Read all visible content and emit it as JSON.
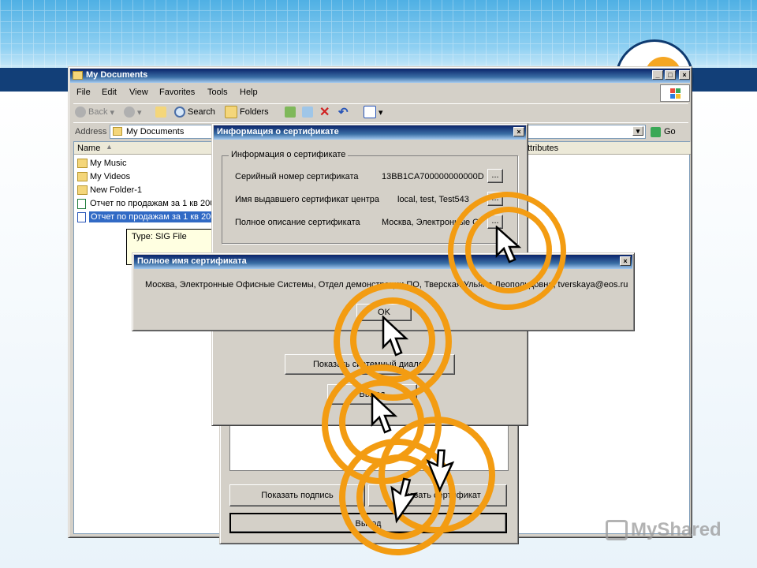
{
  "explorer": {
    "title": "My Documents",
    "menu": [
      "File",
      "Edit",
      "View",
      "Favorites",
      "Tools",
      "Help"
    ],
    "toolbar": {
      "back": "Back",
      "search": "Search",
      "folders": "Folders"
    },
    "address_label": "Address",
    "address_value": "My Documents",
    "go_label": "Go",
    "columns": {
      "name": "Name",
      "attributes": "ttributes"
    },
    "files": [
      {
        "name": "My Music",
        "icon": "music-folder-icon"
      },
      {
        "name": "My Videos",
        "icon": "video-folder-icon"
      },
      {
        "name": "New Folder-1",
        "icon": "folder-icon"
      },
      {
        "name": "Отчет по продажам за 1 кв 200",
        "icon": "excel-file-icon"
      },
      {
        "name": "Отчет по продажам за 1 кв 200",
        "icon": "sig-file-icon",
        "selected": true
      }
    ],
    "tooltip": "Type: SIG File"
  },
  "cert_dialog": {
    "title": "Информация о сертификате",
    "group_label": "Информация о сертификате",
    "rows": [
      {
        "label": "Серийный номер сертификата",
        "value": "13BB1CA700000000000D"
      },
      {
        "label": "Имя выдавшего сертификат центра",
        "value": "local, test, Test543"
      },
      {
        "label": "Полное описание сертификата",
        "value": "Москва, Электронные О"
      }
    ],
    "ellipsis": "...",
    "show_system_button": "Показать системный диалог",
    "exit_button": "Выход"
  },
  "name_dialog": {
    "title": "Полное имя сертификата",
    "text": "Москва, Электронные Офисные Системы, Отдел демонстрации ПО, Тверская Ульяна Леопольдовна, tverskaya@eos.ru",
    "ok_button": "OK"
  },
  "bottom_dialog": {
    "show_signature_button": "Показать подпись",
    "show_certificate_button": "Показать сертификат",
    "exit_button": "Выход"
  },
  "watermark": "MyShared",
  "colors": {
    "highlight_ring": "#f39c12",
    "title_bar": "#0a246a",
    "slide_band": "#123f78"
  }
}
